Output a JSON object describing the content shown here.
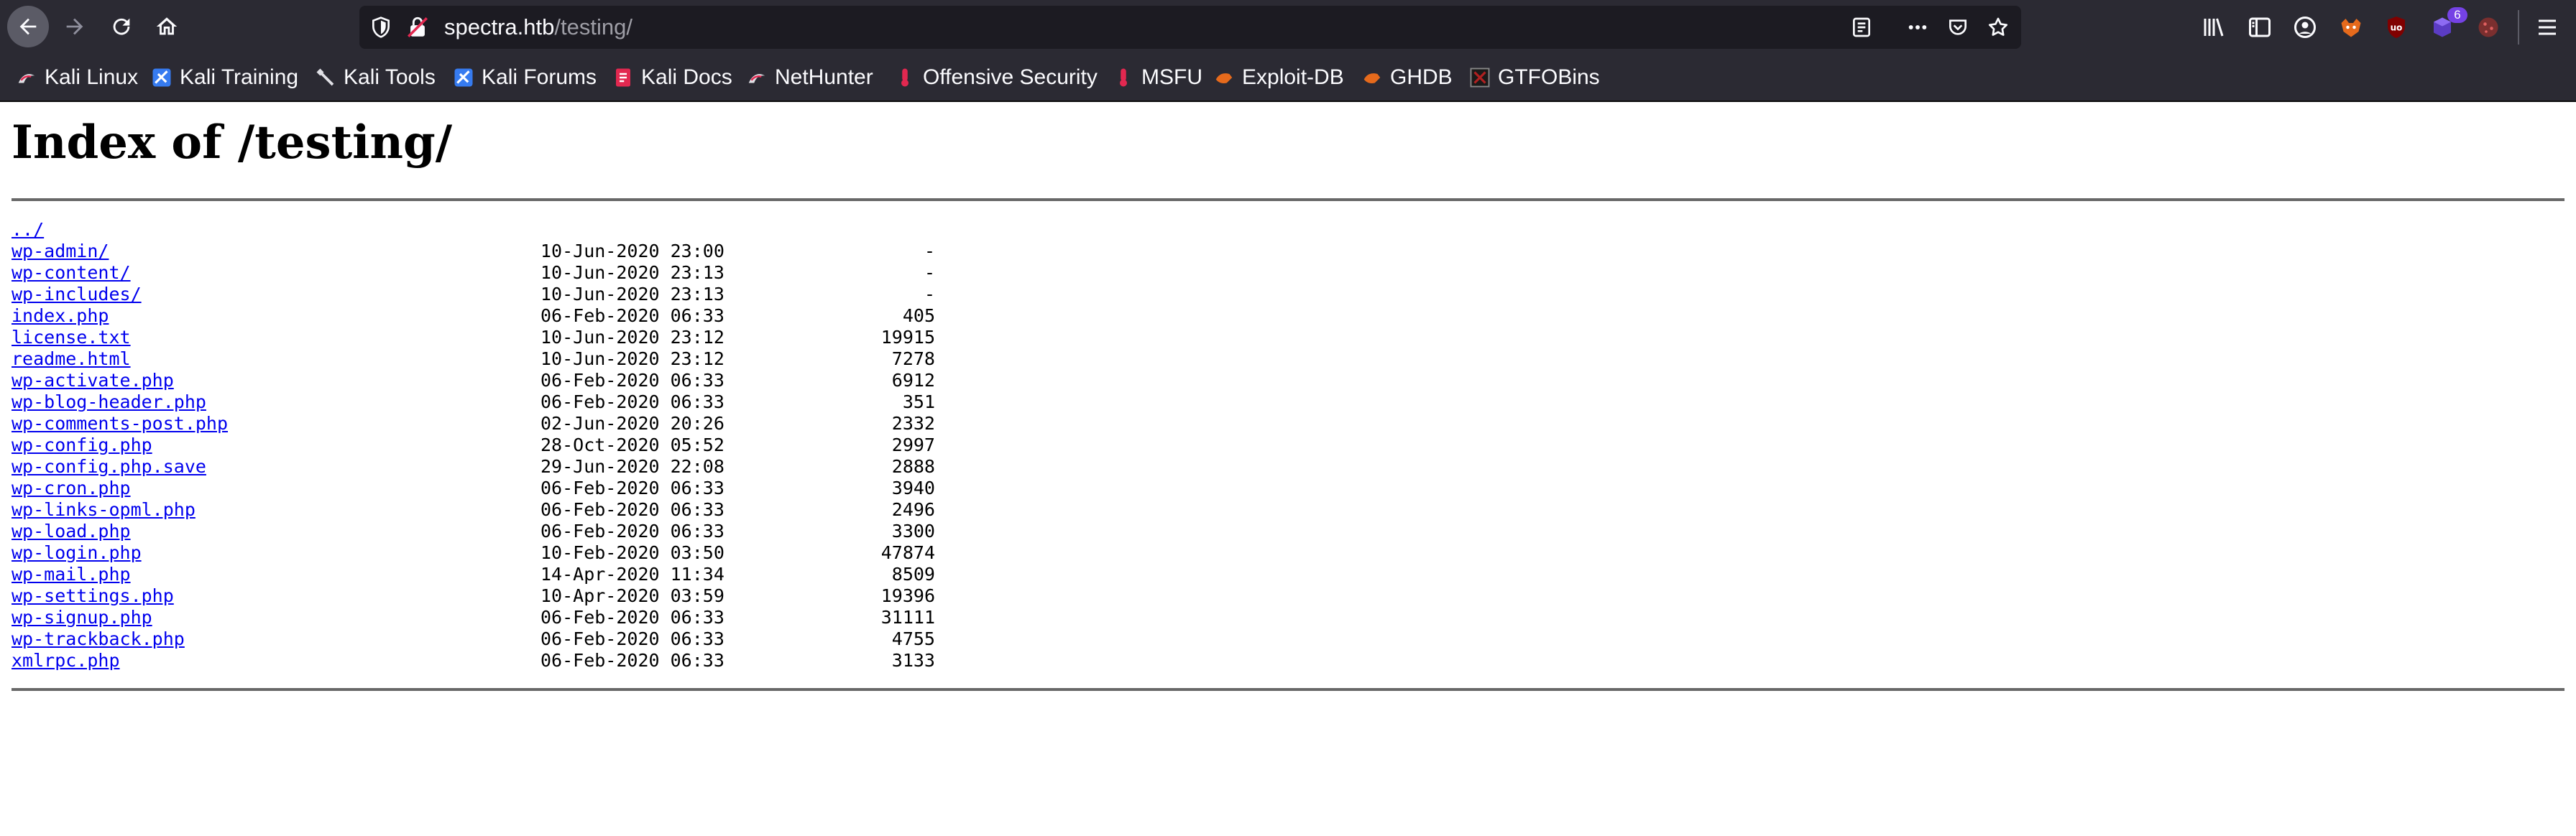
{
  "browser": {
    "url_host": "spectra.htb",
    "url_path": "/testing/",
    "extension_badge": "6"
  },
  "bookmarks": [
    {
      "label": "Kali Linux",
      "icon": "kali-linux-icon"
    },
    {
      "label": "Kali Training",
      "icon": "kali-training-icon"
    },
    {
      "label": "Kali Tools",
      "icon": "kali-tools-icon"
    },
    {
      "label": "Kali Forums",
      "icon": "kali-forums-icon"
    },
    {
      "label": "Kali Docs",
      "icon": "kali-docs-icon"
    },
    {
      "label": "NetHunter",
      "icon": "nethunter-icon"
    },
    {
      "label": "Offensive Security",
      "icon": "offensive-security-icon"
    },
    {
      "label": "MSFU",
      "icon": "msfu-icon"
    },
    {
      "label": "Exploit-DB",
      "icon": "exploit-db-icon"
    },
    {
      "label": "GHDB",
      "icon": "ghdb-icon"
    },
    {
      "label": "GTFOBins",
      "icon": "gtfobins-icon"
    }
  ],
  "page": {
    "title": "Index of /testing/",
    "parent_link": "../",
    "entries": [
      {
        "name": "wp-admin/",
        "date": "10-Jun-2020 23:00",
        "size": "-"
      },
      {
        "name": "wp-content/",
        "date": "10-Jun-2020 23:13",
        "size": "-"
      },
      {
        "name": "wp-includes/",
        "date": "10-Jun-2020 23:13",
        "size": "-"
      },
      {
        "name": "index.php",
        "date": "06-Feb-2020 06:33",
        "size": "405"
      },
      {
        "name": "license.txt",
        "date": "10-Jun-2020 23:12",
        "size": "19915"
      },
      {
        "name": "readme.html",
        "date": "10-Jun-2020 23:12",
        "size": "7278"
      },
      {
        "name": "wp-activate.php",
        "date": "06-Feb-2020 06:33",
        "size": "6912"
      },
      {
        "name": "wp-blog-header.php",
        "date": "06-Feb-2020 06:33",
        "size": "351"
      },
      {
        "name": "wp-comments-post.php",
        "date": "02-Jun-2020 20:26",
        "size": "2332"
      },
      {
        "name": "wp-config.php",
        "date": "28-Oct-2020 05:52",
        "size": "2997"
      },
      {
        "name": "wp-config.php.save",
        "date": "29-Jun-2020 22:08",
        "size": "2888"
      },
      {
        "name": "wp-cron.php",
        "date": "06-Feb-2020 06:33",
        "size": "3940"
      },
      {
        "name": "wp-links-opml.php",
        "date": "06-Feb-2020 06:33",
        "size": "2496"
      },
      {
        "name": "wp-load.php",
        "date": "06-Feb-2020 06:33",
        "size": "3300"
      },
      {
        "name": "wp-login.php",
        "date": "10-Feb-2020 03:50",
        "size": "47874"
      },
      {
        "name": "wp-mail.php",
        "date": "14-Apr-2020 11:34",
        "size": "8509"
      },
      {
        "name": "wp-settings.php",
        "date": "10-Apr-2020 03:59",
        "size": "19396"
      },
      {
        "name": "wp-signup.php",
        "date": "06-Feb-2020 06:33",
        "size": "31111"
      },
      {
        "name": "wp-trackback.php",
        "date": "06-Feb-2020 06:33",
        "size": "4755"
      },
      {
        "name": "xmlrpc.php",
        "date": "06-Feb-2020 06:33",
        "size": "3133"
      }
    ]
  }
}
